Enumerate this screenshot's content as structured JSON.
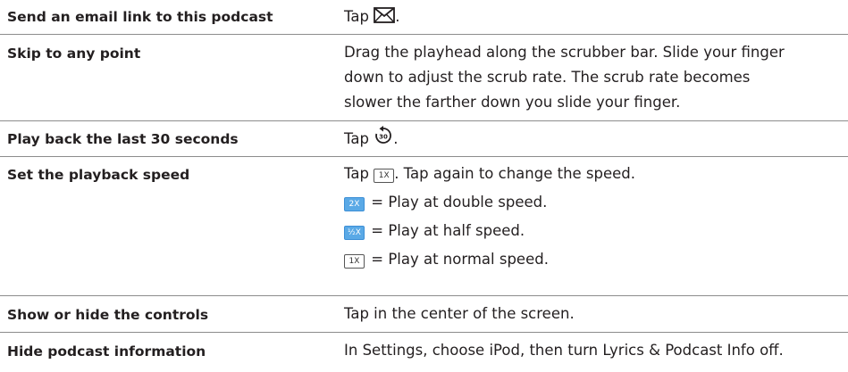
{
  "rows": [
    {
      "action": "Send an email link to this podcast",
      "desc_prefix": "Tap",
      "desc_suffix": ".",
      "icon": "envelope-icon"
    },
    {
      "action": "Skip to any point",
      "desc_lines": [
        "Drag the playhead along the scrubber bar. Slide your finger",
        "down to adjust the scrub rate. The scrub rate becomes",
        "slower the farther down you slide your finger."
      ]
    },
    {
      "action": "Play back the last 30 seconds",
      "desc_prefix": "Tap",
      "desc_suffix": ".",
      "icon": "skip-back-30-icon",
      "icon_label": "30"
    },
    {
      "action": "Set the playback speed",
      "intro_prefix": "Tap",
      "intro_badge": "1X",
      "intro_suffix": ". Tap again to change the speed.",
      "speeds": [
        {
          "badge": "2X",
          "text": "= Play at double speed.",
          "style": "blue"
        },
        {
          "badge": "½X",
          "text": "= Play at half speed.",
          "style": "blue"
        },
        {
          "badge": "1X",
          "text": "= Play at normal speed.",
          "style": "outline"
        }
      ]
    },
    {
      "action": "Show or hide the controls",
      "desc": "Tap in the center of the screen."
    },
    {
      "action": "Hide podcast information",
      "desc": "In Settings, choose iPod, then turn Lyrics & Podcast Info off."
    }
  ],
  "colors": {
    "text": "#231f20",
    "rule": "#8c8c8c",
    "badge_blue": "#5aa9e6"
  }
}
